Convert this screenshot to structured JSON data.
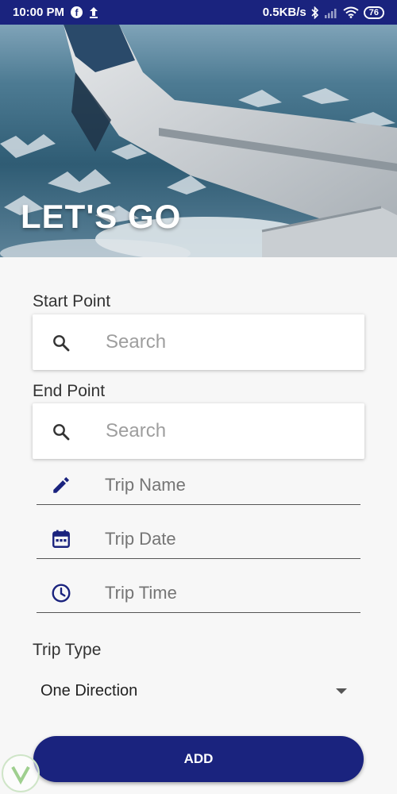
{
  "status_bar": {
    "time": "10:00 PM",
    "network_speed": "0.5KB/s",
    "battery": "76"
  },
  "hero": {
    "title": "LET'S GO"
  },
  "form": {
    "start_point": {
      "label": "Start Point",
      "placeholder": "Search"
    },
    "end_point": {
      "label": "End Point",
      "placeholder": "Search"
    },
    "trip_name": {
      "placeholder": "Trip Name"
    },
    "trip_date": {
      "placeholder": "Trip Date"
    },
    "trip_time": {
      "placeholder": "Trip Time"
    },
    "trip_type": {
      "label": "Trip Type",
      "selected": "One Direction"
    },
    "add_button": "ADD"
  },
  "colors": {
    "primary": "#1a237e",
    "background": "#f7f7f7"
  }
}
